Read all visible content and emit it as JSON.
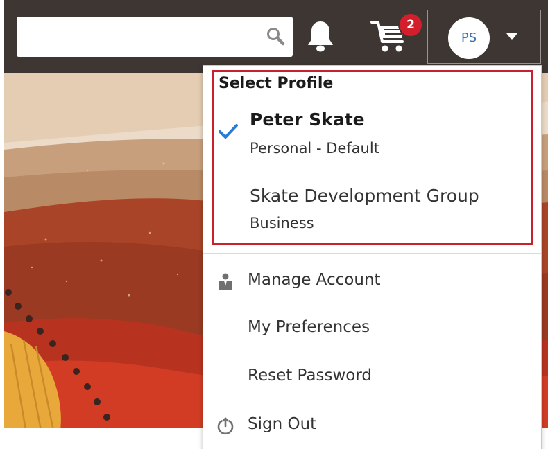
{
  "header": {
    "search": {
      "value": "",
      "placeholder": ""
    },
    "cart": {
      "badge_count": "2"
    },
    "profile": {
      "initials": "PS"
    }
  },
  "dropdown": {
    "section_title": "Select Profile",
    "profiles": [
      {
        "name": "Peter Skate",
        "subtitle": "Personal - Default",
        "selected": true
      },
      {
        "name": "Skate Development Group",
        "subtitle": "Business",
        "selected": false
      }
    ],
    "menu_items": [
      {
        "label": "Manage Account",
        "icon": "user-icon"
      },
      {
        "label": "My Preferences",
        "icon": ""
      },
      {
        "label": "Reset Password",
        "icon": ""
      },
      {
        "label": "Sign Out",
        "icon": "power-icon"
      }
    ]
  },
  "colors": {
    "header_bg": "#3e3632",
    "badge": "#d21f2b",
    "highlight_border": "#c8202c",
    "check": "#2b7bd6",
    "avatar_text": "#3a6fb0"
  }
}
